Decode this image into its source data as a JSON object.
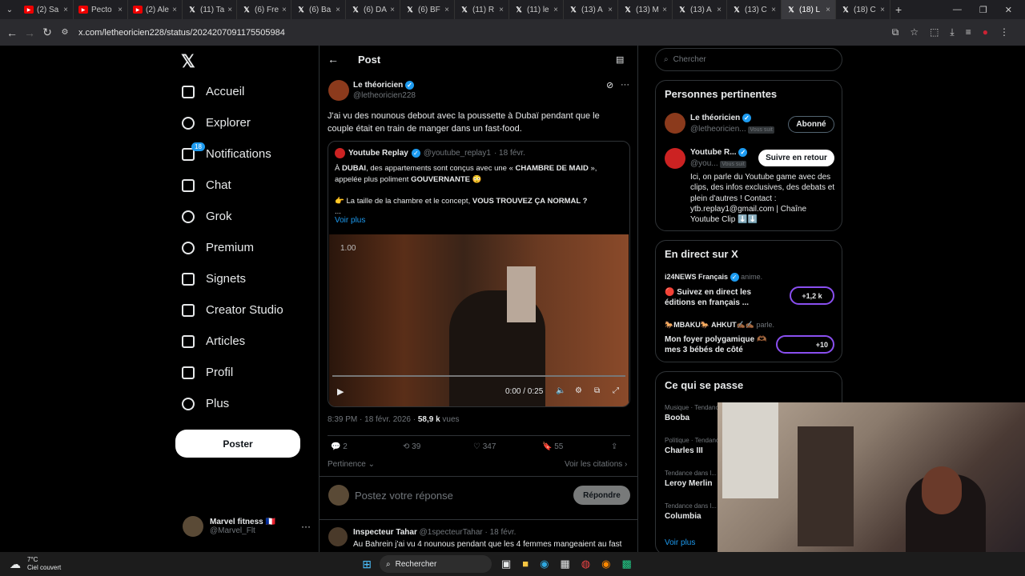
{
  "browser": {
    "tabs": [
      {
        "title": "(2) Sa",
        "icon": "youtube-icon"
      },
      {
        "title": "Pecto",
        "icon": "youtube-icon"
      },
      {
        "title": "(2) Ale",
        "icon": "youtube-icon"
      },
      {
        "title": "(11) Ta",
        "icon": "x-icon"
      },
      {
        "title": "(6) Fre",
        "icon": "x-icon"
      },
      {
        "title": "(6) Ba",
        "icon": "x-icon"
      },
      {
        "title": "(6) DA",
        "icon": "x-icon"
      },
      {
        "title": "(6) BF",
        "icon": "x-icon"
      },
      {
        "title": "(11) R",
        "icon": "x-icon"
      },
      {
        "title": "(11) le",
        "icon": "x-icon"
      },
      {
        "title": "(13) A",
        "icon": "x-icon"
      },
      {
        "title": "(13) M",
        "icon": "x-icon"
      },
      {
        "title": "(13) A",
        "icon": "x-icon"
      },
      {
        "title": "(13) C",
        "icon": "x-icon"
      },
      {
        "title": "(18) L",
        "icon": "x-icon",
        "active": true
      },
      {
        "title": "(18) C",
        "icon": "x-icon"
      }
    ],
    "url": "x.com/letheoricien228/status/2024207091175505984"
  },
  "nav": {
    "items": [
      {
        "label": "Accueil",
        "icon": "home-icon"
      },
      {
        "label": "Explorer",
        "icon": "search-icon"
      },
      {
        "label": "Notifications",
        "icon": "bell-icon",
        "badge": "18"
      },
      {
        "label": "Chat",
        "icon": "mail-icon"
      },
      {
        "label": "Grok",
        "icon": "grok-icon"
      },
      {
        "label": "Premium",
        "icon": "premium-icon"
      },
      {
        "label": "Signets",
        "icon": "bookmark-icon"
      },
      {
        "label": "Creator Studio",
        "icon": "creator-icon"
      },
      {
        "label": "Articles",
        "icon": "articles-icon"
      },
      {
        "label": "Profil",
        "icon": "user-icon"
      },
      {
        "label": "Plus",
        "icon": "more-icon"
      }
    ],
    "post_button": "Poster",
    "account_name": "Marvel fitness 🇫🇷",
    "account_handle": "@Marvel_Flt"
  },
  "post": {
    "header_title": "Post",
    "author_name": "Le théoricien",
    "author_handle": "@letheoricien228",
    "text": "J'ai vu des nounous debout avec la poussette à Dubaï pendant que le couple était en train de manger dans un fast-food.",
    "quote": {
      "name": "Youtube Replay",
      "handle": "@youtube_replay1",
      "date": "· 18 févr.",
      "line1_prefix": "À ",
      "line1_b1": "DUBAI",
      "line1_mid": ", des appartements sont conçus avec une « ",
      "line1_b2": "CHAMBRE DE MAID",
      "line1_end": " »,",
      "line2_prefix": "appelée plus poliment ",
      "line2_b": "GOUVERNANTE",
      "line2_emoji": "😳",
      "line3_emoji": "👉",
      "line3_text": " La taille de la chambre et le concept, ",
      "line3_b": "VOUS TROUVEZ ÇA NORMAL ?",
      "ellipsis": "...",
      "more": "Voir plus",
      "video_speed": "1.00",
      "video_time": "0:00 / 0:25"
    },
    "meta_time": "8:39 PM · 18 févr. 2026 · ",
    "meta_views": "58,9 k",
    "meta_views_label": " vues",
    "stats": {
      "replies": "2",
      "reposts": "39",
      "likes": "347",
      "bookmarks": "55"
    },
    "sort_label": "Pertinence",
    "quotes_link": "Voir les citations",
    "reply_placeholder": "Postez votre réponse",
    "reply_button": "Répondre",
    "next_reply": {
      "name": "Inspecteur Tahar",
      "handle": "@1specteurTahar",
      "date": "· 18 févr.",
      "text": "Au Bahrein j'ai vu 4 nounous pendant que les 4 femmes mangeaient au fast"
    }
  },
  "right": {
    "search_placeholder": "Chercher",
    "relevant_title": "Personnes pertinentes",
    "people": [
      {
        "name": "Le théoricien",
        "handle": "@letheoricien...",
        "follows_you": "Vous suit",
        "button": "Abonné"
      },
      {
        "name": "Youtube R...",
        "handle": "@you...",
        "follows_you": "Vous suit",
        "button": "Suivre en retour",
        "bio": "Ici, on parle du Youtube game avec des clips, des infos exclusives, des debats et plein d'autres ! Contact : ytb.replay1@gmail.com | Chaîne Youtube Clip ⬇️⬇️"
      }
    ],
    "live_title": "En direct sur X",
    "lives": [
      {
        "host": "i24NEWS Français",
        "role": "anime.",
        "title": "🔴 Suivez en direct les éditions en français ...",
        "count": "+1,2 k"
      },
      {
        "host": "🐎MBAKU🐎 AHKUT✍🏾✍🏾",
        "role": "parle.",
        "title": "Mon foyer polygamique 🫶🏾 mes 3 bébés de côté",
        "count": "+10"
      }
    ],
    "trends_title": "Ce qui se passe",
    "trends": [
      {
        "cat": "Musique · Tendances",
        "name": "Booba"
      },
      {
        "cat": "Politique · Tendances",
        "name": "Charles III"
      },
      {
        "cat": "Tendance dans l...",
        "name": "Leroy Merlin"
      },
      {
        "cat": "Tendance dans l...",
        "name": "Columbia"
      }
    ],
    "trends_more": "Voir plus"
  },
  "taskbar": {
    "temp": "7°C",
    "weather": "Ciel couvert",
    "search": "Rechercher"
  },
  "colors": {
    "accent": "#1d9bf0",
    "bg": "#000000",
    "border": "#2f3336"
  }
}
